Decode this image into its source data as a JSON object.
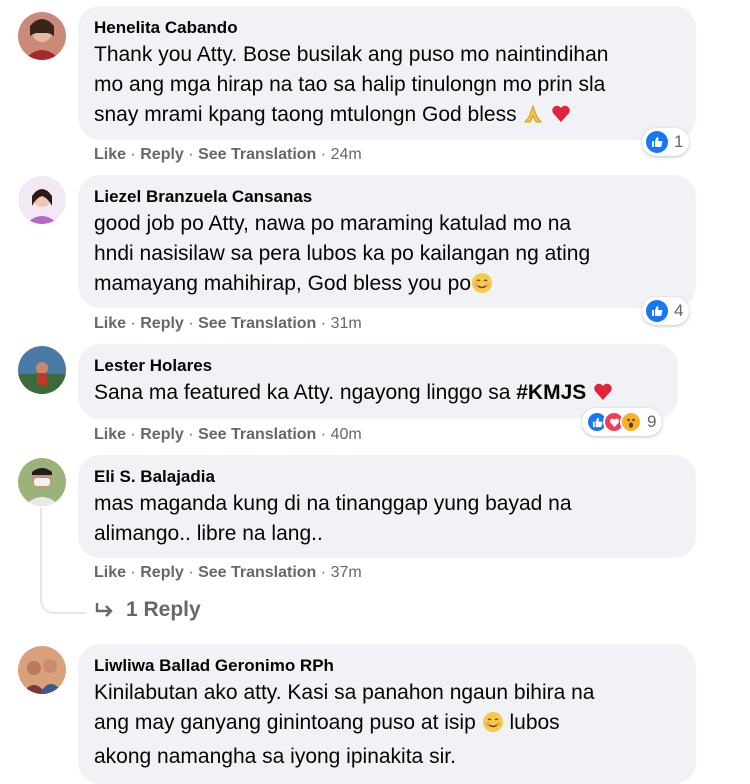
{
  "comments": [
    {
      "author": "Henelita Cabando",
      "lines": [
        "Thank you Atty. Bose busilak ang puso mo naintindihan",
        "mo ang mga hirap na tao sa halip tinulongn mo prin sla",
        "snay mrami kpang taong mtulongn God bless"
      ],
      "emojis": [
        "folded-hands-emoji",
        "heart-emoji"
      ],
      "actions": {
        "like": "Like",
        "reply": "Reply",
        "translate": "See Translation",
        "time": "24m"
      },
      "reaction_count": "1",
      "reactions": [
        "like"
      ]
    },
    {
      "author": "Liezel Branzuela Cansanas",
      "lines": [
        "good job po Atty, nawa po maraming katulad mo na",
        "hndi nasisilaw sa pera lubos ka po kailangan ng ating",
        "mamayang mahihirap, God bless you po"
      ],
      "emojis": [
        "smiling-face-emoji"
      ],
      "actions": {
        "like": "Like",
        "reply": "Reply",
        "translate": "See Translation",
        "time": "31m"
      },
      "reaction_count": "4",
      "reactions": [
        "like"
      ]
    },
    {
      "author": "Lester Holares",
      "line_prefix": "Sana ma featured ka Atty. ngayong linggo sa",
      "hashtag": "#KMJS",
      "emojis": [
        "heart-emoji"
      ],
      "actions": {
        "like": "Like",
        "reply": "Reply",
        "translate": "See Translation",
        "time": "40m"
      },
      "reaction_count": "9",
      "reactions": [
        "like",
        "love",
        "wow"
      ]
    },
    {
      "author": "Eli S. Balajadia",
      "lines": [
        "mas maganda kung di na tinanggap yung bayad na",
        "alimango.. libre na lang.."
      ],
      "actions": {
        "like": "Like",
        "reply": "Reply",
        "translate": "See Translation",
        "time": "37m"
      },
      "replies_label": "1 Reply"
    },
    {
      "author": "Liwliwa Ballad Geronimo RPh",
      "lines": [
        "Kinilabutan ako atty. Kasi sa panahon ngaun bihira na",
        "ang may ganyang ginintoang puso at isip",
        "akong namangha sa iyong ipinakita sir."
      ],
      "line2_suffix": "lubos",
      "emojis": [
        "smiling-face-emoji"
      ]
    }
  ],
  "separator": "·",
  "colors": {
    "bubble": "#f0f2f5",
    "meta": "#65676b",
    "like": "#1877f2",
    "love": "#f33e58",
    "wow": "#f7b125"
  }
}
